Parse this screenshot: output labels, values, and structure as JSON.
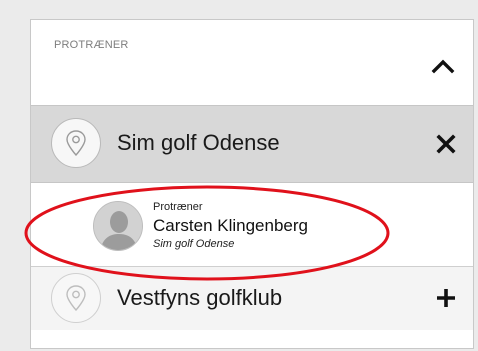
{
  "section": {
    "caption": "PROTRÆNER",
    "collapse_icon": "chevron-up-icon"
  },
  "selected_club": {
    "name": "Sim golf Odense",
    "icon": "location-pin-icon",
    "action_icon": "close-icon"
  },
  "trainer": {
    "role": "Protræner",
    "name": "Carsten Klingenberg",
    "club": "Sim golf Odense",
    "avatar_icon": "person-avatar-icon"
  },
  "other_club": {
    "name": "Vestfyns golfklub",
    "icon": "location-pin-icon",
    "action_icon": "plus-icon"
  },
  "colors": {
    "highlight_oval": "#e0111b",
    "selected_row_bg": "#d8d8d8",
    "page_bg": "#ebebeb"
  }
}
